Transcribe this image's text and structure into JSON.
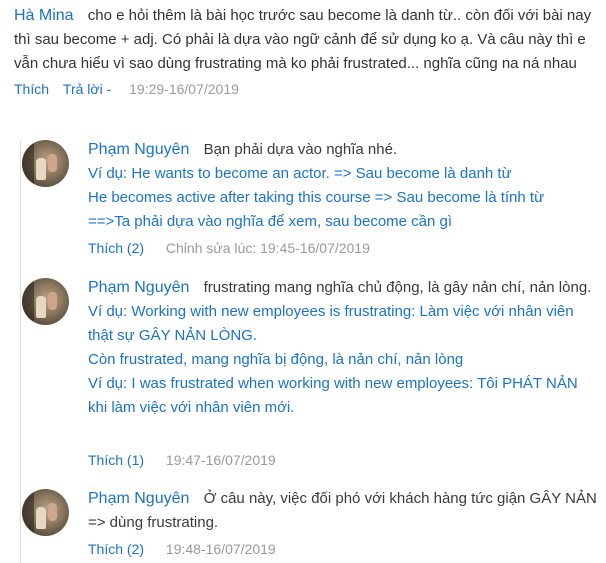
{
  "top_comment": {
    "author": "Hà Mina",
    "text": "cho e hỏi thêm là bài học trước sau become là danh từ.. còn đối với bài nay thì sau become + adj. Có phải là dựa vào ngữ cảnh để sử dụng ko ạ. Và câu này thì e vẫn chưa hiểu vì sao dùng frustrating mà ko phải frustrated... nghĩa cũng na ná nhau",
    "like_label": "Thích",
    "reply_label": "Trả lời -",
    "time": "19:29-16/07/2019"
  },
  "replies": [
    {
      "author": "Phạm Nguyên",
      "first_text": "Bạn phải dựa vào nghĩa nhé.",
      "lines": [
        "Ví dụ: He wants to become an actor. => Sau become là danh từ",
        "He becomes active after taking this course => Sau become là tính từ",
        "==>Ta phải dựa vào nghĩa để xem, sau become cần gì"
      ],
      "like_label": "Thích (2)",
      "time": "Chỉnh sửa lúc: 19:45-16/07/2019"
    },
    {
      "author": "Phạm Nguyên",
      "first_text": "frustrating mang nghĩa chủ động, là gây nản chí, nản lòng.",
      "lines": [
        "Ví dụ: Working with new employees is frustrating: Làm việc với nhân viên thật sự GÂY NẢN LÒNG.",
        "Còn frustrated, mang nghĩa bị động, là nản chí, nản lòng",
        "Ví dụ: I was frustrated when working with new employees: Tôi PHÁT NẢN khi làm việc với nhân viên mới."
      ],
      "like_label": "Thích (1)",
      "time": "19:47-16/07/2019"
    },
    {
      "author": "Phạm Nguyên",
      "first_text": "Ở câu này, việc đối phó với khách hàng tức giận GÂY NẢN => dùng frustrating.",
      "lines": [],
      "like_label": "Thích (2)",
      "time": "19:48-16/07/2019"
    }
  ]
}
